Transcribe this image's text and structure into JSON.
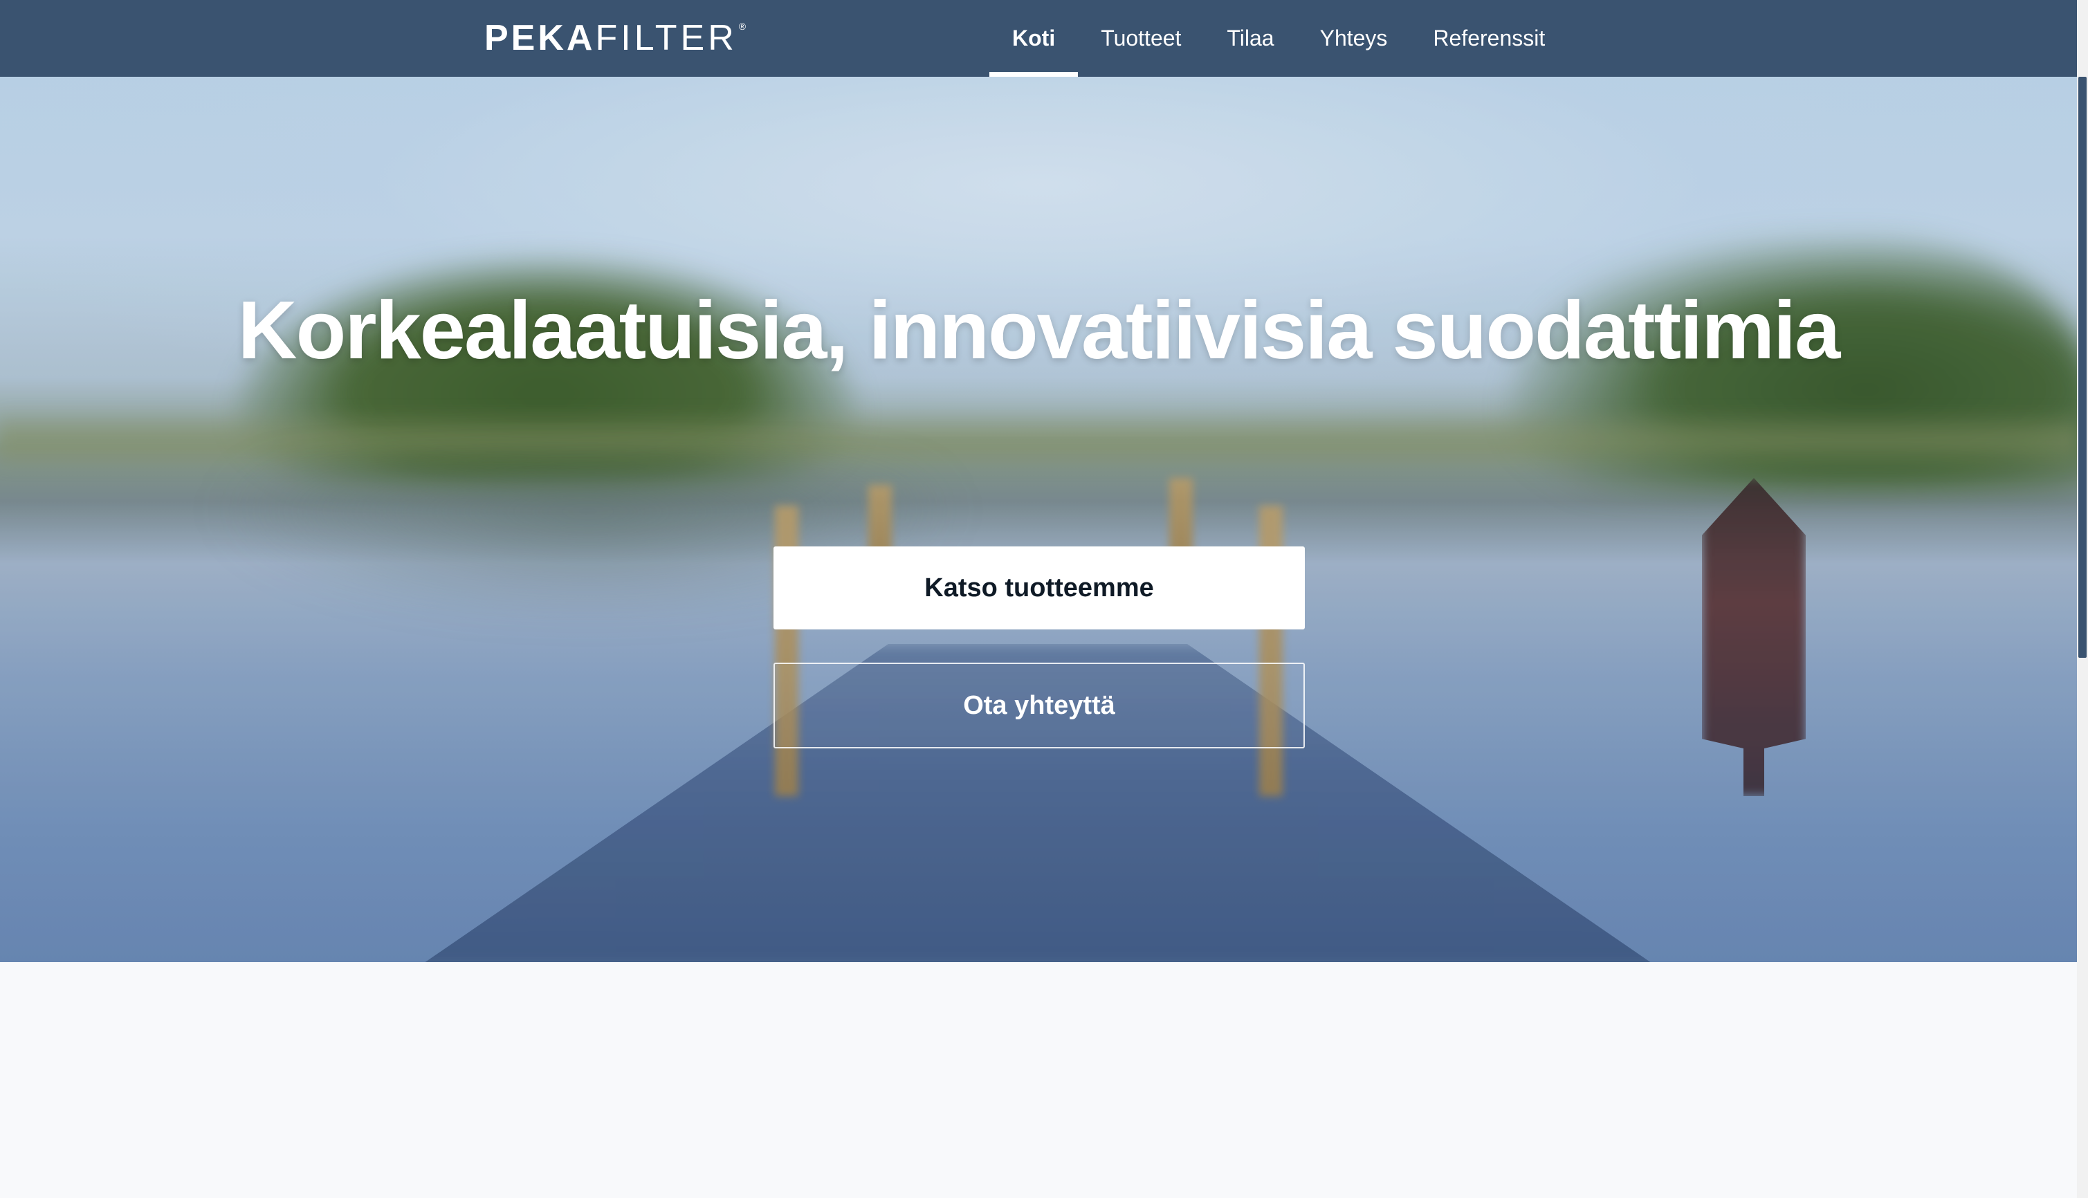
{
  "brand": {
    "logo_bold": "PEKA",
    "logo_light": "FILTER",
    "logo_mark": "®"
  },
  "nav": {
    "items": [
      {
        "label": "Koti",
        "active": true
      },
      {
        "label": "Tuotteet",
        "active": false
      },
      {
        "label": "Tilaa",
        "active": false
      },
      {
        "label": "Yhteys",
        "active": false
      },
      {
        "label": "Referenssit",
        "active": false
      }
    ]
  },
  "hero": {
    "title": "Korkealaatuisia, innovatiivisia suodattimia",
    "primary_button": "Katso tuotteemme",
    "secondary_button": "Ota yhteyttä"
  },
  "colors": {
    "navbar": "#3a5370",
    "page_background": "#f8f9fb",
    "primary_button_bg": "#ffffff",
    "primary_button_text": "#0f1a26",
    "text_on_dark": "#ffffff"
  },
  "icons": {
    "logo": "pekafilter-wordmark"
  }
}
